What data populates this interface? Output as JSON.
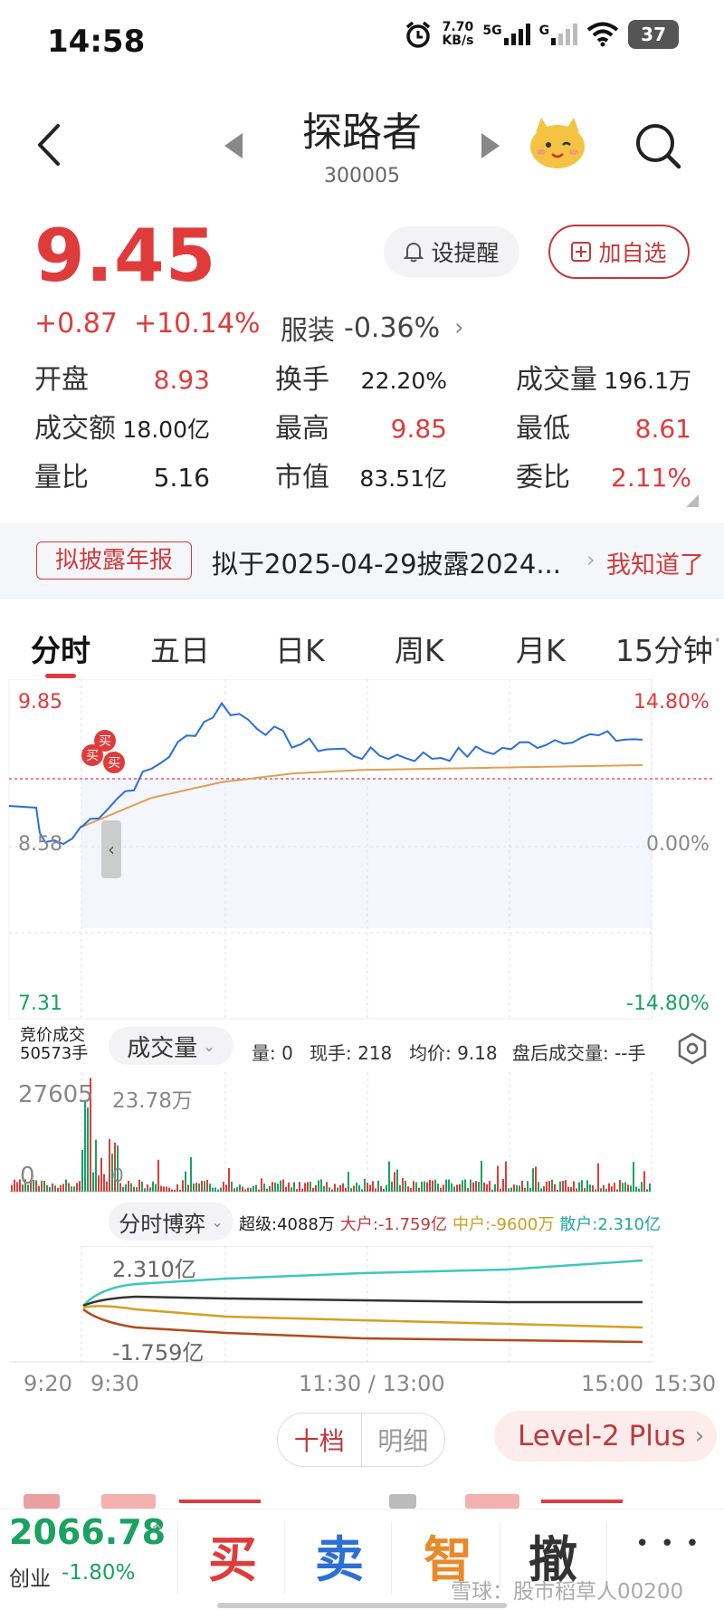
{
  "status_bar": {
    "time": "14:58",
    "net_speed_value": "7.70",
    "net_speed_unit": "KB/s",
    "signal_1": "5G",
    "signal_2": "G",
    "battery": "37"
  },
  "header": {
    "title": "探路者",
    "code": "300005"
  },
  "quote": {
    "price": "9.45",
    "change": "+0.87",
    "change_pct": "+10.14%",
    "sector_name": "服装",
    "sector_change": "-0.36%",
    "remind_label": "设提醒",
    "add_label": "加自选"
  },
  "stats": [
    {
      "label": "开盘",
      "value": "8.93"
    },
    {
      "label": "换手",
      "value": "22.20%"
    },
    {
      "label": "成交量",
      "value": "196.1万"
    },
    {
      "label": "成交额",
      "value": "18.00亿"
    },
    {
      "label": "最高",
      "value": "9.85"
    },
    {
      "label": "最低",
      "value": "8.61"
    },
    {
      "label": "量比",
      "value": "5.16"
    },
    {
      "label": "市值",
      "value": "83.51亿"
    },
    {
      "label": "委比",
      "value": "2.11%"
    }
  ],
  "notice": {
    "tag": "拟披露年报",
    "text": "拟于2025-04-29披露2024...",
    "action": "我知道了"
  },
  "tabs": [
    "分时",
    "五日",
    "日K",
    "周K",
    "月K",
    "15分钟"
  ],
  "price_chart": {
    "price_high": "9.85",
    "price_mid": "8.58",
    "price_low": "7.31",
    "pct_high": "14.80%",
    "pct_mid": "0.00%",
    "pct_low": "-14.80%",
    "buy_marker": "买"
  },
  "volume_panel": {
    "auction_label": "竞价成交",
    "auction_volume": "50573手",
    "dropdown_label": "成交量",
    "vol": "量: 0",
    "current_hand": "现手: 218",
    "avg_price": "均价: 9.18",
    "after_hours": "盘后成交量: --手",
    "y_max_left": "27605",
    "y_max_right": "23.78万",
    "y_zero_left": "0",
    "y_zero_right": "0"
  },
  "game_panel": {
    "dropdown_label": "分时博弈",
    "super": "超级:4088万",
    "large": "大户:-1.759亿",
    "medium": "中户:-9600万",
    "retail": "散户:2.310亿",
    "y_top": "2.310亿",
    "y_bottom": "-1.759亿"
  },
  "time_axis": [
    "9:20",
    "9:30",
    "11:30 / 13:00",
    "15:00",
    "15:30"
  ],
  "depth": {
    "tab_ten": "十档",
    "tab_detail": "明细",
    "level2": "Level-2 Plus"
  },
  "bottom": {
    "index_value": "2066.78",
    "index_name": "创业",
    "index_change": "-1.80%",
    "buy": "买",
    "sell": "卖",
    "smart": "智",
    "cancel": "撤",
    "more": "• • •",
    "watermark": "雪球：股市稻草人00200"
  },
  "chart_data": {
    "type": "line",
    "x": [
      "9:30",
      "10:00",
      "10:30",
      "11:00",
      "11:30",
      "13:30",
      "14:00",
      "14:30",
      "14:58"
    ],
    "series": [
      {
        "values": [
          8.78,
          9.25,
          9.78,
          9.48,
          9.38,
          9.36,
          9.42,
          9.53,
          9.5
        ]
      },
      {
        "values": [
          8.78,
          9.02,
          9.15,
          9.22,
          9.25,
          9.26,
          9.27,
          9.28,
          9.29
        ]
      }
    ],
    "ylim": [
      7.31,
      9.85
    ]
  },
  "colors": {
    "up": "#e03b3b",
    "down": "#1aa260",
    "price_line": "#2c6fd6",
    "avg_line": "#e0a050",
    "super_line": "#333333",
    "large_line": "#b34a1a",
    "medium_line": "#d4a020",
    "retail_line": "#3ec7bd"
  }
}
